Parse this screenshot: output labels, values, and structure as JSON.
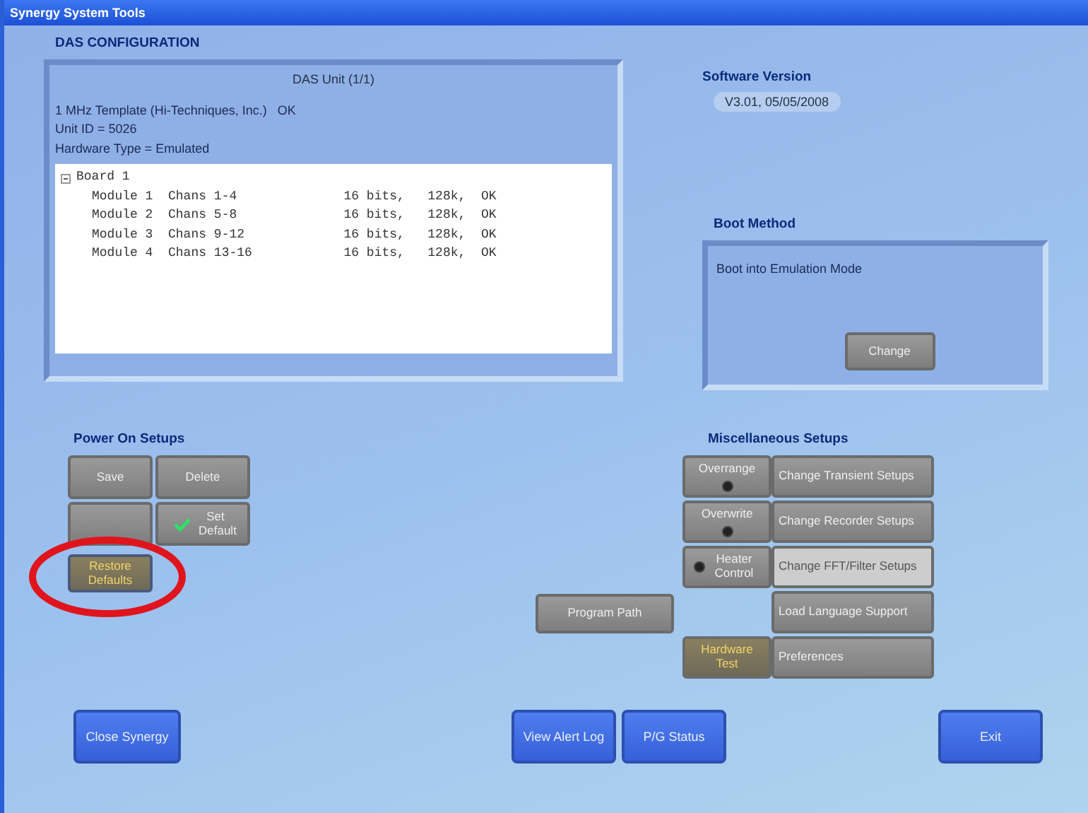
{
  "window": {
    "title": "Synergy System Tools"
  },
  "das": {
    "heading": "DAS CONFIGURATION",
    "unit": "DAS Unit (1/1)",
    "lines": [
      "1 MHz Template (Hi-Techniques, Inc.)   OK",
      "Unit ID = 5026",
      "Hardware Type = Emulated"
    ],
    "tree": {
      "label": "Board 1",
      "expanded": true,
      "children": [
        {
          "module": "Module 1",
          "chans": "Chans 1-4",
          "bits": "16 bits,",
          "mem": "128k,",
          "status": "OK"
        },
        {
          "module": "Module 2",
          "chans": "Chans 5-8",
          "bits": "16 bits,",
          "mem": "128k,",
          "status": "OK"
        },
        {
          "module": "Module 3",
          "chans": "Chans 9-12",
          "bits": "16 bits,",
          "mem": "128k,",
          "status": "OK"
        },
        {
          "module": "Module 4",
          "chans": "Chans 13-16",
          "bits": "16 bits,",
          "mem": "128k,",
          "status": "OK"
        }
      ]
    }
  },
  "software": {
    "label": "Software Version",
    "value": "V3.01, 05/05/2008"
  },
  "boot": {
    "label": "Boot Method",
    "text": "Boot into Emulation Mode",
    "button": "Change"
  },
  "power": {
    "label": "Power On Setups",
    "buttons": [
      {
        "kind": "plain",
        "label": "Save"
      },
      {
        "kind": "plain",
        "label": "Delete"
      },
      {
        "kind": "blank"
      },
      {
        "kind": "check",
        "label": "Set Default",
        "checked": true
      },
      {
        "kind": "accent",
        "label": "Restore Defaults",
        "circled": true
      }
    ]
  },
  "misc": {
    "label": "Miscellaneous Setups",
    "toggles": [
      {
        "label": "Overrange",
        "on": true,
        "dot_first": false
      },
      {
        "label": "Overwrite",
        "on": true,
        "dot_first": false
      },
      {
        "label": "Heater Control",
        "on": true,
        "dot_first": true
      }
    ],
    "extra": {
      "label": "Hardware Test"
    },
    "path": {
      "label": "Program Path"
    },
    "actions": [
      {
        "label": "Change Transient Setups",
        "disabled": false
      },
      {
        "label": "Change Recorder Setups",
        "disabled": false
      },
      {
        "label": "Change FFT/Filter Setups",
        "disabled": true
      },
      {
        "label": "Load Language Support",
        "disabled": false
      },
      {
        "label": "Preferences",
        "disabled": false
      }
    ]
  },
  "bottom": {
    "left": [
      {
        "label": "Close Synergy"
      }
    ],
    "center": [
      {
        "label": "View Alert Log"
      },
      {
        "label": "P/G Status"
      }
    ],
    "right": [
      {
        "label": "Exit"
      }
    ]
  }
}
